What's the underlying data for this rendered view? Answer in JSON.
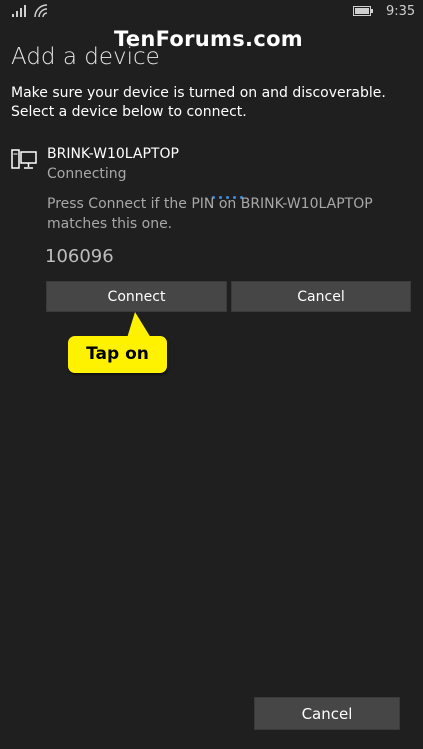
{
  "status_bar": {
    "time": "9:35",
    "signal_icon": "signal-bars-icon",
    "wifi_icon": "wifi-icon",
    "battery_icon": "battery-icon"
  },
  "watermark": "TenForums.com",
  "page": {
    "title": "Add a device",
    "instructions": "Make sure your device is turned on and discoverable. Select a device below to connect."
  },
  "device": {
    "icon": "computer-icon",
    "name": "BRINK-W10LAPTOP",
    "status": "Connecting",
    "pin_message": "Press Connect if the PIN on BRINK-W10LAPTOP matches this one.",
    "pin": "106096"
  },
  "buttons": {
    "connect": "Connect",
    "cancel": "Cancel",
    "bottom_cancel": "Cancel"
  },
  "callout": {
    "label": "Tap on",
    "color": "#fff200"
  },
  "colors": {
    "background": "#1f1f1f",
    "button": "#464646",
    "progress_dots": "#3b8fd9"
  }
}
